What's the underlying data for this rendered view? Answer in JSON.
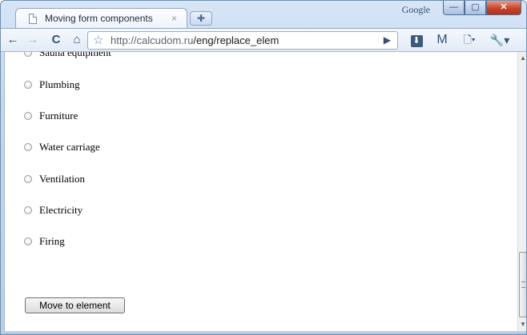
{
  "window": {
    "brand": "Google",
    "controls": {
      "minimize": "—",
      "maximize": "▢",
      "close": "✕"
    }
  },
  "tab": {
    "title": "Moving form components",
    "close": "×",
    "new_tab": "✚"
  },
  "toolbar": {
    "back": "←",
    "forward": "→",
    "reload": "C",
    "home": "⌂",
    "bookmark_star": "☆",
    "url_host": "http://calcudom.ru",
    "url_path": "/eng/replace_elem",
    "go": "▶",
    "save": "⬇",
    "gmail": "M",
    "page_menu": "🗋▾",
    "wrench_menu": "🔧▾"
  },
  "content": {
    "options": [
      "Sauna equipment",
      "Plumbing",
      "Furniture",
      "Water carriage",
      "Ventilation",
      "Electricity",
      "Firing"
    ],
    "button_label": "Move to element"
  },
  "scrollbar": {
    "up": "▲",
    "down": "▼"
  },
  "icons": [
    "page-icon",
    "close-icon",
    "new-tab-icon",
    "back-icon",
    "forward-icon",
    "reload-icon",
    "home-icon",
    "star-icon",
    "go-icon",
    "save-icon",
    "gmail-icon",
    "page-menu-icon",
    "wrench-icon"
  ]
}
